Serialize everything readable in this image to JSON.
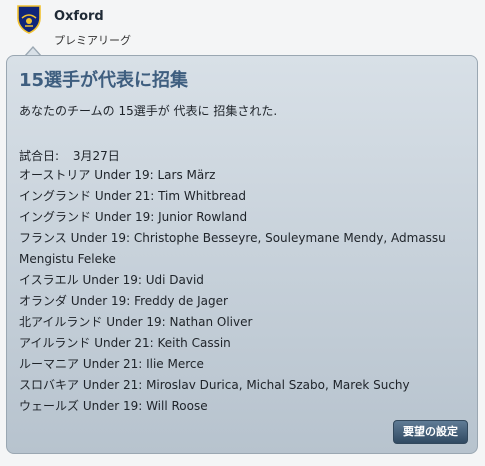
{
  "header": {
    "club_name": "Oxford",
    "league": "プレミアリーグ"
  },
  "notification": {
    "title": "15選手が代表に招集",
    "intro": "あなたのチームの 15選手が 代表に 招集された.",
    "match_date_label": "試合日:",
    "match_date": "3月27日",
    "callups": [
      {
        "line": "オーストリア Under 19: Lars März"
      },
      {
        "line": "イングランド Under 21: Tim Whitbread"
      },
      {
        "line": "イングランド Under 19: Junior Rowland"
      },
      {
        "line": "フランス Under 19: Christophe Besseyre, Souleymane Mendy, Admassu Mengistu Feleke"
      },
      {
        "line": "イスラエル Under 19: Udi David"
      },
      {
        "line": "オランダ Under 19: Freddy de Jager"
      },
      {
        "line": "北アイルランド Under 19: Nathan Oliver"
      },
      {
        "line": "アイルランド Under 21: Keith Cassin"
      },
      {
        "line": "ルーマニア Under 21: Ilie Merce"
      },
      {
        "line": "スロバキア Under 21: Miroslav Durica, Michal Szabo, Marek Suchy"
      },
      {
        "line": "ウェールズ Under 19: Will Roose"
      }
    ],
    "action_label": "要望の設定"
  },
  "colors": {
    "title": "#3e5e7f",
    "button": "#314a62",
    "bubble_top": "#d8e0e7",
    "bubble_bottom": "#b7c3ce"
  },
  "icons": {
    "crest": "club-crest-icon"
  }
}
